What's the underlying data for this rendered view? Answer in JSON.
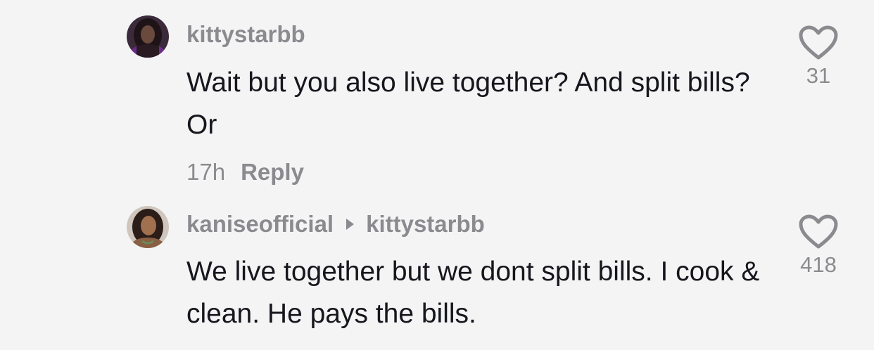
{
  "comments": [
    {
      "username": "kittystarbb",
      "text": "Wait but you also live together? And split bills? Or",
      "timestamp": "17h",
      "reply_label": "Reply",
      "like_count": "31",
      "like_icon": "heart-outline-icon",
      "avatar": "user-avatar-purple"
    },
    {
      "username": "kaniseofficial",
      "reply_arrow_icon": "caret-right-icon",
      "reply_to": "kittystarbb",
      "text": "We live together but we dont split bills. I cook & clean. He pays the bills.",
      "like_count": "418",
      "like_icon": "heart-outline-icon",
      "avatar": "user-avatar-tan"
    }
  ],
  "colors": {
    "background": "#f5f4f5",
    "primary_text": "#16171d",
    "secondary_text": "#8b8b8f"
  }
}
